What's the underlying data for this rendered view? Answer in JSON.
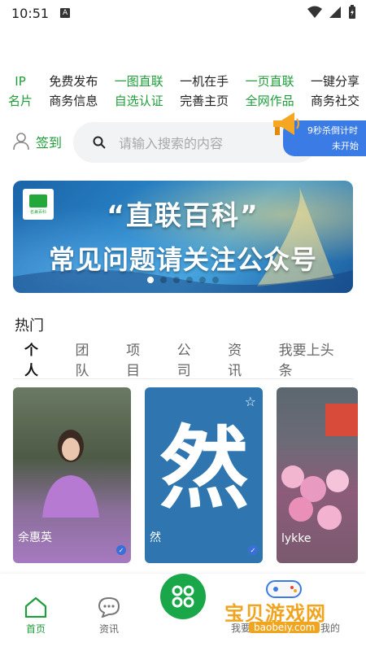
{
  "status_bar": {
    "time": "10:51",
    "a_label": "A"
  },
  "features": [
    {
      "line1": "IP",
      "line2": "名片",
      "color": "green"
    },
    {
      "line1": "免费发布",
      "line2": "商务信息",
      "color": "dark"
    },
    {
      "line1": "一图直联",
      "line2": "自选认证",
      "color": "green"
    },
    {
      "line1": "一机在手",
      "line2": "完善主页",
      "color": "dark"
    },
    {
      "line1": "一页直联",
      "line2": "全网作品",
      "color": "green"
    },
    {
      "line1": "一键分享",
      "line2": "商务社交",
      "color": "dark"
    }
  ],
  "header": {
    "sign_in_label": "签到",
    "search_placeholder": "请输入搜索的内容",
    "promo_line1": "9秒杀倒计时",
    "promo_line2": "未开始"
  },
  "banner": {
    "title": "“直联百科”",
    "subtitle": "常见问题请关注公众号",
    "logo_text": "名兼百科",
    "dot_count": 6,
    "active_dot": 0
  },
  "hot": {
    "title": "热门",
    "tabs": [
      "个人",
      "团队",
      "项目",
      "公司",
      "资讯",
      "我要上头条"
    ],
    "active_tab": 0
  },
  "cards": [
    {
      "name": "余惠英"
    },
    {
      "name": "然",
      "glyph": "然"
    },
    {
      "name": "lykke"
    }
  ],
  "bottom_nav": {
    "home": "首页",
    "news": "资讯",
    "left_partial": "我要",
    "mine": "我的"
  },
  "watermark": {
    "brand": "宝贝游戏网",
    "url": "baobeiy.com"
  },
  "colors": {
    "brand_green": "#1f9d3a",
    "promo_blue": "#3a7be6",
    "fab_green": "#1aa74a"
  }
}
